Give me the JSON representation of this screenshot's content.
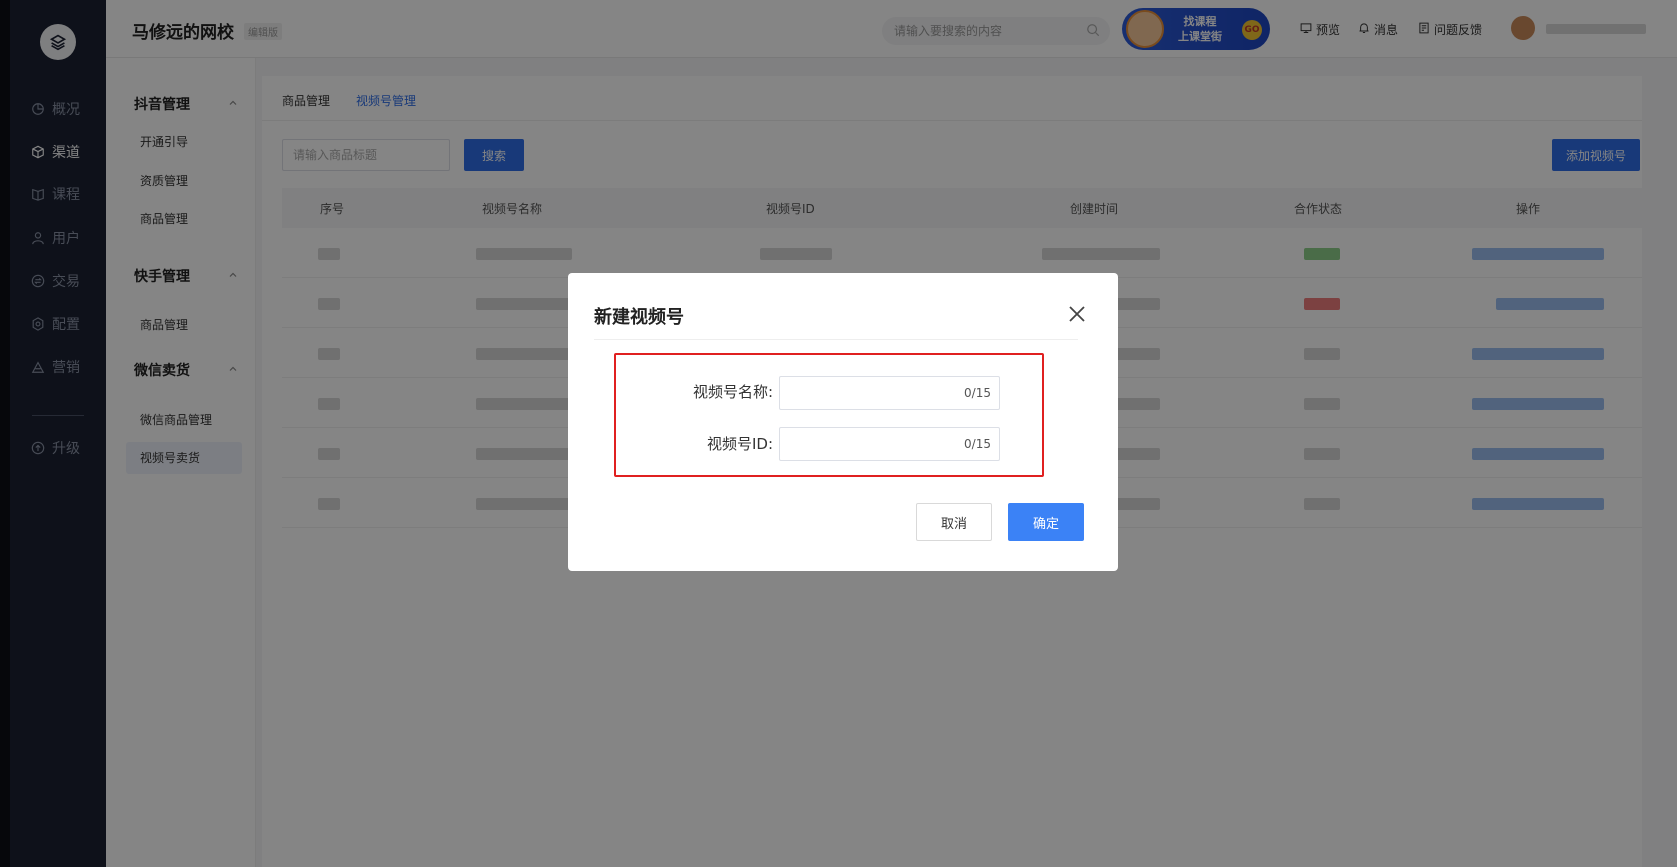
{
  "rail": {
    "items": [
      {
        "label": "概况",
        "icon": "pie-chart-icon"
      },
      {
        "label": "渠道",
        "icon": "cube-icon"
      },
      {
        "label": "课程",
        "icon": "book-icon"
      },
      {
        "label": "用户",
        "icon": "user-icon"
      },
      {
        "label": "交易",
        "icon": "exchange-icon"
      },
      {
        "label": "配置",
        "icon": "gear-icon"
      },
      {
        "label": "营销",
        "icon": "marketing-icon"
      },
      {
        "label": "升级",
        "icon": "upgrade-icon"
      }
    ],
    "active": "渠道"
  },
  "header": {
    "brand": "马修远的网校",
    "brand_tag": "编辑版",
    "search_placeholder": "请输入要搜索的内容",
    "banner_line1": "找课程",
    "banner_line2": "上课堂街",
    "banner_go": "GO",
    "preview": "预览",
    "messages": "消息",
    "feedback": "问题反馈"
  },
  "subnav": {
    "group1": "抖音管理",
    "group1_items": [
      "开通引导",
      "资质管理",
      "商品管理"
    ],
    "group2": "快手管理",
    "group2_items": [
      "商品管理"
    ],
    "group3": "微信卖货",
    "group3_items": [
      "微信商品管理",
      "视频号卖货"
    ],
    "active": "视频号卖货"
  },
  "main": {
    "breadcrumbs": [
      "商品管理",
      "视频号管理"
    ],
    "search_placeholder": "请输入商品标题",
    "search_button": "搜索",
    "add_button": "添加视频号",
    "columns": [
      "序号",
      "视频号名称",
      "视频号ID",
      "创建时间",
      "合作状态",
      "操作"
    ],
    "row_statuses": [
      "green",
      "red",
      "gray",
      "gray",
      "gray",
      "gray"
    ]
  },
  "modal": {
    "title": "新建视频号",
    "name_label": "视频号名称:",
    "name_value": "",
    "name_count": "0/15",
    "id_label": "视频号ID:",
    "id_value": "",
    "id_count": "0/15",
    "cancel": "取消",
    "confirm": "确定"
  },
  "colors": {
    "primary": "#2f6ee8",
    "confirm": "#3b82f6",
    "highlight_border": "#e02020",
    "rail_bg": "#1b2233"
  }
}
